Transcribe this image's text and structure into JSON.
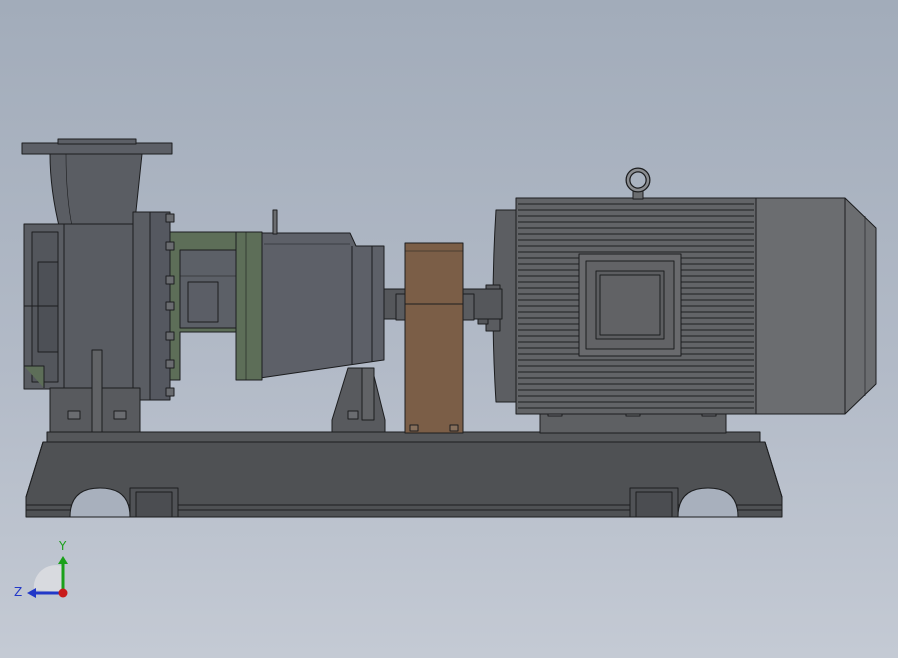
{
  "viewport": {
    "background_top": "#a2acba",
    "background_bottom": "#c4cad4"
  },
  "model": {
    "components": [
      {
        "name": "base-frame",
        "color": "#4f5154"
      },
      {
        "name": "pump-casing",
        "color": "#5a5d63"
      },
      {
        "name": "bearing-bracket",
        "color": "#5d6e58"
      },
      {
        "name": "bearing-housing",
        "color": "#5d6068"
      },
      {
        "name": "coupling-guard",
        "color": "#7b5e47"
      },
      {
        "name": "electric-motor",
        "color": "#626467"
      },
      {
        "name": "motor-terminal-box",
        "color": "#666769"
      },
      {
        "name": "lifting-eye",
        "color": "#6b6d70"
      }
    ],
    "edge_color": "#1c1d1f"
  },
  "triad": {
    "x_label": "",
    "y_label": "Y",
    "z_label": "Z",
    "y_color": "#1aa01a",
    "z_color": "#2238c8",
    "x_color": "#c81a1a"
  }
}
